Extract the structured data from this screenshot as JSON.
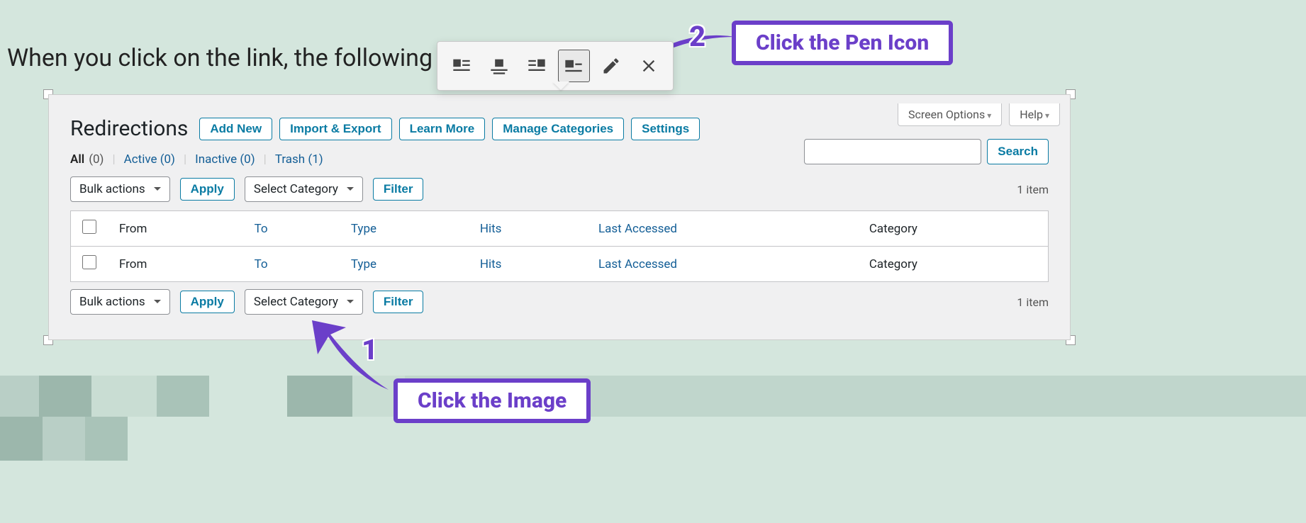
{
  "intro": "When you click on the link, the following s",
  "callouts": {
    "image": "Click the Image",
    "pen": "Click the Pen Icon"
  },
  "numbers": {
    "one": "1",
    "two": "2"
  },
  "toolbar": {
    "align_left": "align-left-icon",
    "align_center": "align-center-icon",
    "align_right": "align-right-icon",
    "align_none": "align-none-icon",
    "edit": "pencil-icon",
    "remove": "remove-icon"
  },
  "wp": {
    "title": "Redirections",
    "screen_options": "Screen Options",
    "help": "Help",
    "buttons": {
      "add_new": "Add New",
      "import_export": "Import & Export",
      "learn_more": "Learn More",
      "manage_categories": "Manage Categories",
      "settings": "Settings"
    },
    "filters": {
      "all": "All",
      "all_count": "(0)",
      "active": "Active",
      "active_count": "(0)",
      "inactive": "Inactive",
      "inactive_count": "(0)",
      "trash": "Trash",
      "trash_count": "(1)"
    },
    "search": {
      "button": "Search",
      "placeholder": ""
    },
    "bulk": {
      "label": "Bulk actions",
      "apply": "Apply"
    },
    "cat": {
      "label": "Select Category",
      "filter": "Filter"
    },
    "items_count": "1 item",
    "columns": {
      "from": "From",
      "to": "To",
      "type": "Type",
      "hits": "Hits",
      "last": "Last Accessed",
      "category": "Category"
    }
  }
}
